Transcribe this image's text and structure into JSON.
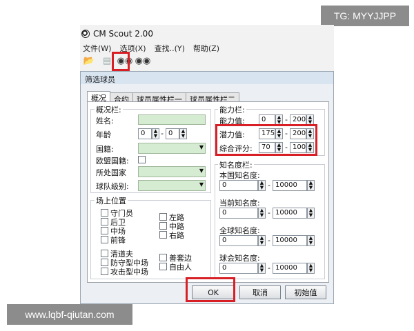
{
  "overlay": {
    "tg": "TG: MYYJJPP",
    "watermark": "www.lqbf-qiutan.com"
  },
  "app": {
    "title": "CM Scout 2.00",
    "menu": [
      "文件(W)",
      "选项(X)",
      "查找..(Y)",
      "帮助(Z)"
    ]
  },
  "dialog": {
    "title": "筛选球员",
    "tabs": [
      "概况",
      "合约",
      "球员属性栏一",
      "球员属性栏二"
    ],
    "overview": {
      "label": "概况栏:",
      "name": "姓名:",
      "age": "年龄",
      "age_from": "0",
      "age_to": "0",
      "nationality": "国籍:",
      "eu": "欧盟国籍:",
      "country": "所处国家",
      "league": "球队级别:"
    },
    "ability": {
      "label": "能力栏:",
      "rows": [
        {
          "label": "能力值:",
          "from": "0",
          "to": "200"
        },
        {
          "label": "潜力值:",
          "from": "175",
          "to": "200"
        },
        {
          "label": "综合评分:",
          "from": "70",
          "to": "100"
        }
      ]
    },
    "fame": {
      "label": "知名度栏:",
      "rows": [
        {
          "label": "本国知名度:",
          "from": "0",
          "to": "10000"
        },
        {
          "label": "当前知名度:",
          "from": "0",
          "to": "10000"
        },
        {
          "label": "全球知名度:",
          "from": "0",
          "to": "10000"
        },
        {
          "label": "球会知名度:",
          "from": "0",
          "to": "10000"
        }
      ]
    },
    "positions": {
      "label": "场上位置",
      "col1": [
        "守门员",
        "后卫",
        "中场",
        "前锋"
      ],
      "col2": [
        "左路",
        "中路",
        "右路"
      ],
      "col3": [
        "清道夫",
        "防守型中场",
        "攻击型中场"
      ],
      "col4": [
        "善套边",
        "自由人"
      ]
    },
    "buttons": {
      "ok": "OK",
      "cancel": "取消",
      "reset": "初始值"
    },
    "dash": "-"
  }
}
